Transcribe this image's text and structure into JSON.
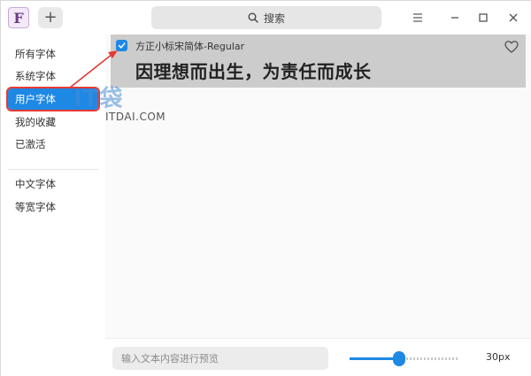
{
  "app": {
    "icon_letter": "F"
  },
  "toolbar": {
    "add_label": "+",
    "search_label": "搜索"
  },
  "sidebar": {
    "items": [
      {
        "label": "所有字体",
        "active": false
      },
      {
        "label": "系统字体",
        "active": false
      },
      {
        "label": "用户字体",
        "active": true
      },
      {
        "label": "我的收藏",
        "active": false
      },
      {
        "label": "已激活",
        "active": false
      }
    ],
    "groups": [
      {
        "label": "中文字体"
      },
      {
        "label": "等宽字体"
      }
    ]
  },
  "font_list": [
    {
      "name": "方正小标宋简体-Regular",
      "preview": "因理想而出生，为责任而成长",
      "checked": true,
      "favorite": false
    }
  ],
  "watermark": {
    "title": "IT袋",
    "subtitle": "ITDAI.COM"
  },
  "bottom": {
    "preview_placeholder": "输入文本内容进行预览",
    "size_label": "30px",
    "size_fraction": 0.45
  },
  "colors": {
    "accent": "#1e88e5",
    "highlight_border": "#e53935",
    "selected_row": "#cccccc"
  }
}
